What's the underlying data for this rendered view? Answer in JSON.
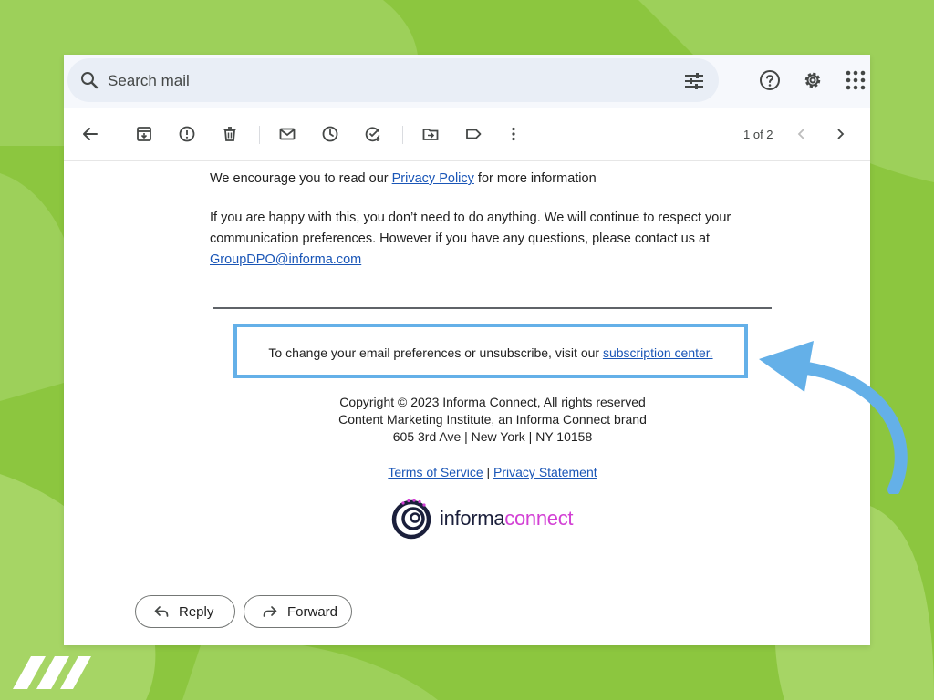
{
  "search": {
    "placeholder": "Search mail"
  },
  "pager": {
    "text": "1 of 2"
  },
  "email": {
    "privacy_prefix": "We encourage you to read our ",
    "privacy_link": "Privacy Policy",
    "privacy_suffix": " for more information",
    "happy_line1": "If you are happy with this, you don’t need to do anything. We will continue to respect your",
    "happy_line2": "communication preferences. However if you have any questions, please contact us at",
    "contact_email": "GroupDPO@informa.com",
    "unsubscribe_prefix": "To change your email preferences or unsubscribe, visit our ",
    "unsubscribe_link": "subscription center.",
    "copyright": "Copyright © 2023 Informa Connect, All rights reserved",
    "brand_line": "Content Marketing Institute, an Informa Connect brand",
    "address": "605 3rd Ave | New York | NY 10158",
    "terms_link": "Terms of Service",
    "links_separator": " | ",
    "privacy_statement_link": "Privacy Statement"
  },
  "logo": {
    "strong": "informa",
    "light": "connect"
  },
  "actions": {
    "reply": "Reply",
    "forward": "Forward"
  },
  "icons": {
    "search": "search-icon",
    "tune": "tune-icon",
    "help": "help-icon",
    "settings": "gear-icon",
    "apps": "apps-grid-icon",
    "back": "back-arrow-icon",
    "archive": "archive-icon",
    "report": "report-spam-icon",
    "delete": "trash-icon",
    "mark_unread": "mail-icon",
    "snooze": "clock-icon",
    "add_task": "add-task-icon",
    "move": "move-to-folder-icon",
    "label": "label-icon",
    "more": "more-vert-icon",
    "prev": "chevron-left-icon",
    "next": "chevron-right-icon",
    "reply": "reply-icon",
    "forward": "forward-icon"
  },
  "colors": {
    "background_green": "#8cc63f",
    "link_blue": "#1a56b7",
    "highlight_blue": "#64b0e8",
    "logo_dark": "#1b1f3b",
    "logo_pink": "#d23fd4"
  }
}
